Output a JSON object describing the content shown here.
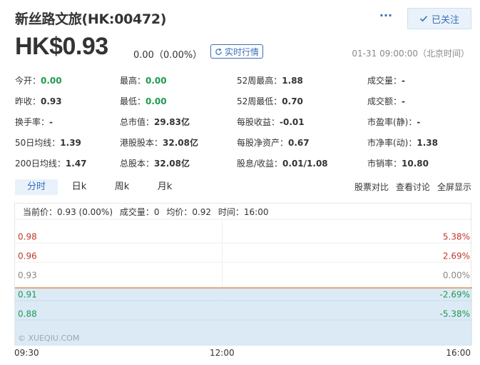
{
  "header": {
    "title": "新丝路文旅(HK:00472)",
    "more_label": "···",
    "follow_label": "已关注"
  },
  "price_bar": {
    "price": "HK$0.93",
    "change": "0.00（0.00%）",
    "realtime_label": "实时行情",
    "datetime": "01-31 09:00:00（北京时间）"
  },
  "quote": {
    "rows": [
      [
        {
          "label": "今开：",
          "value": "0.00",
          "green": true
        },
        {
          "label": "最高：",
          "value": "0.00",
          "green": true
        },
        {
          "label": "52周最高：",
          "value": "1.88"
        },
        {
          "label": "成交量：",
          "value": "-"
        }
      ],
      [
        {
          "label": "昨收：",
          "value": "0.93"
        },
        {
          "label": "最低：",
          "value": "0.00",
          "green": true
        },
        {
          "label": "52周最低：",
          "value": "0.70"
        },
        {
          "label": "成交额：",
          "value": "-"
        }
      ],
      [
        {
          "label": "换手率：",
          "value": "-"
        },
        {
          "label": "总市值：",
          "value": "29.83亿"
        },
        {
          "label": "每股收益：",
          "value": "-0.01"
        },
        {
          "label": "市盈率(静)：",
          "value": "-"
        }
      ],
      [
        {
          "label": "50日均线：",
          "value": "1.39"
        },
        {
          "label": "港股股本：",
          "value": "32.08亿"
        },
        {
          "label": "每股净资产：",
          "value": "0.67"
        },
        {
          "label": "市净率(动)：",
          "value": "1.38"
        }
      ],
      [
        {
          "label": "200日均线：",
          "value": "1.47"
        },
        {
          "label": "总股本：",
          "value": "32.08亿"
        },
        {
          "label": "股息/收益：",
          "value": "0.01/1.08"
        },
        {
          "label": "市销率：",
          "value": "10.80"
        }
      ]
    ]
  },
  "tabs": {
    "period": [
      "分时",
      "日k",
      "周k",
      "月k"
    ],
    "active_index": 0,
    "right_links": [
      "股票对比",
      "查看讨论",
      "全屏显示"
    ]
  },
  "chart_info": {
    "current_price": "当前价：0.93 (0.00%)",
    "volume": "成交量：0",
    "average": "均价：0.92",
    "time": "时间：16:00"
  },
  "colors": {
    "accent": "#3a6fb7",
    "up": "#c0392b",
    "down": "#1d9a4c",
    "flat": "#888888",
    "fill": "#d6e6f4",
    "price_line": "#e07b39"
  },
  "chart_data": {
    "type": "line",
    "watermark": "© XUEQIU.COM",
    "x_labels": [
      "09:30",
      "12:00",
      "16:00"
    ],
    "y_ticks": [
      {
        "value": "0.98",
        "pct": "5.38%",
        "trend": "up"
      },
      {
        "value": "0.96",
        "pct": "2.69%",
        "trend": "up"
      },
      {
        "value": "0.93",
        "pct": "0.00%",
        "trend": "flat"
      },
      {
        "value": "0.91",
        "pct": "-2.69%",
        "trend": "down"
      },
      {
        "value": "0.88",
        "pct": "-5.38%",
        "trend": "down"
      }
    ],
    "prev_close": 0.93,
    "series": [
      {
        "values": [
          0.93,
          0.93
        ]
      }
    ]
  }
}
